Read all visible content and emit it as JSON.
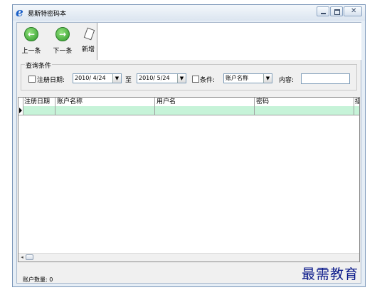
{
  "window": {
    "title": "易斯特密码本",
    "app_icon": "e"
  },
  "toolbar": {
    "prev_label": "上一条",
    "next_label": "下一条",
    "new_label": "新增"
  },
  "query": {
    "legend": "查询条件",
    "reg_date_label": "注册日期:",
    "date_from": "2010/ 4/24",
    "to_label": "至",
    "date_to": "2010/ 5/24",
    "condition_label": "条件:",
    "condition_value": "账户名称",
    "content_label": "内容:",
    "content_value": ""
  },
  "grid": {
    "columns": [
      "注册日期",
      "账户名称",
      "用户名",
      "密码",
      "描"
    ],
    "rows": [
      [
        "",
        "",
        "",
        "",
        ""
      ]
    ]
  },
  "status": {
    "account_count_label": "账户数量:",
    "account_count": "0"
  },
  "watermark": "最需教育",
  "colors": {
    "selected_row": "#c6f3d8",
    "title_icon": "#1a5fc8"
  }
}
